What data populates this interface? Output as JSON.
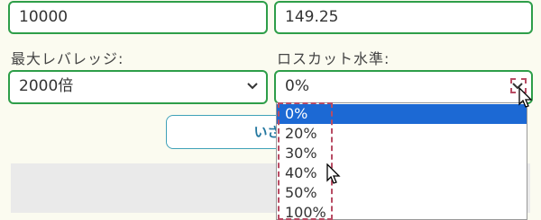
{
  "fields": {
    "top_left_value": "10000",
    "top_right_value": "149.25",
    "leverage_label": "最大レバレッジ:",
    "leverage_value": "2000倍",
    "losscut_label": "ロスカット水準:",
    "losscut_value": "0%"
  },
  "button": {
    "label": "いざ計"
  },
  "dropdown": {
    "options": [
      "0%",
      "20%",
      "30%",
      "40%",
      "50%",
      "100%"
    ],
    "selected_index": 0
  },
  "colors": {
    "field_border": "#2e9e49",
    "selected_option": "#1c69d4",
    "highlight_dash": "#b84c64"
  },
  "icons": {
    "chevron": "chevron-down-icon",
    "cursor": "mouse-pointer-icon"
  }
}
